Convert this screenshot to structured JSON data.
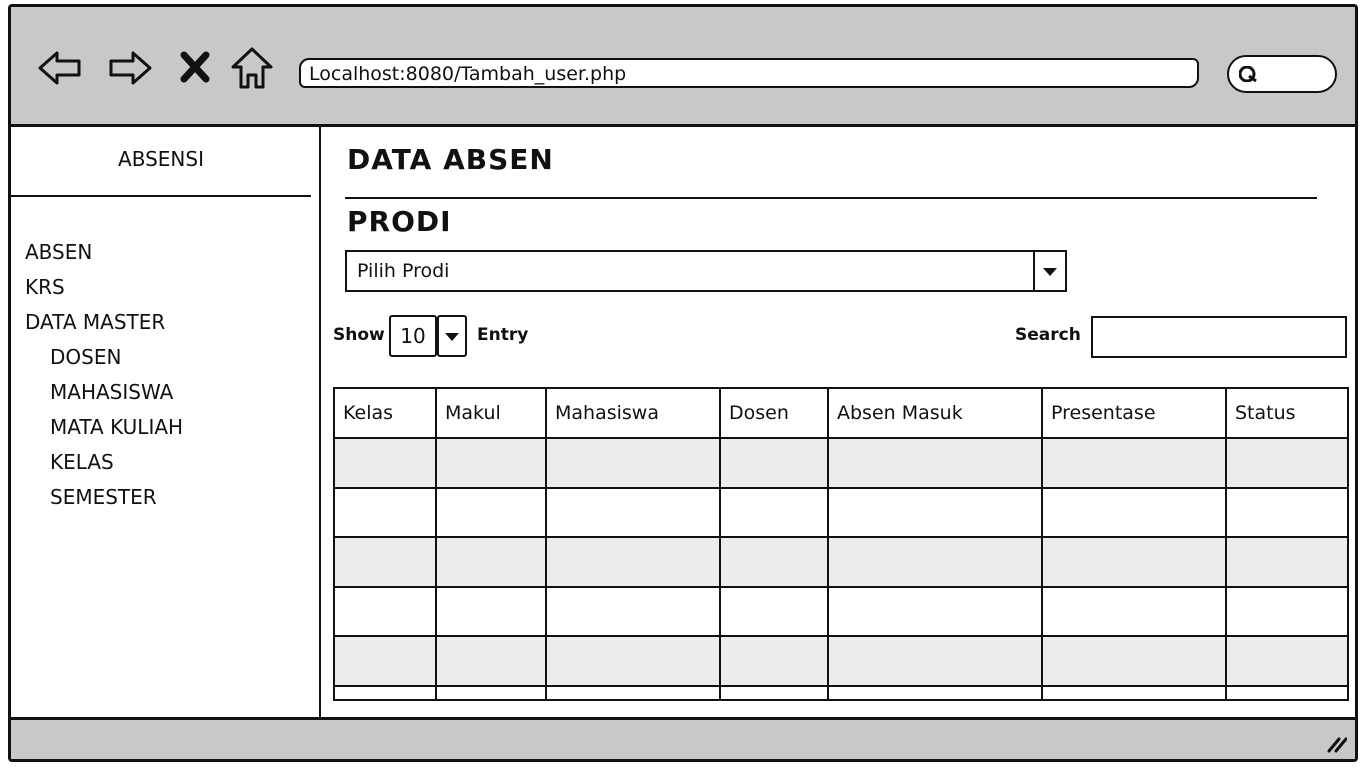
{
  "browser": {
    "url": "Localhost:8080/Tambah_user.php",
    "buttons": {
      "back": "back-arrow-icon",
      "forward": "forward-arrow-icon",
      "stop": "close-icon",
      "home": "home-icon"
    },
    "search_icon": "search-icon"
  },
  "sidebar": {
    "title": "ABSENSI",
    "items": [
      {
        "label": "ABSEN"
      },
      {
        "label": "KRS"
      },
      {
        "label": "DATA MASTER"
      }
    ],
    "subitems": [
      {
        "label": "DOSEN"
      },
      {
        "label": "MAHASISWA"
      },
      {
        "label": "MATA KULIAH"
      },
      {
        "label": "KELAS"
      },
      {
        "label": "SEMESTER"
      }
    ]
  },
  "main": {
    "title": "DATA ABSEN",
    "prodi_label": "PRODI",
    "prodi_select": {
      "value": "Pilih Prodi"
    },
    "show_label": "Show",
    "entries_value": "10",
    "entry_label": "Entry",
    "search_label": "Search",
    "table": {
      "columns": [
        "Kelas",
        "Makul",
        "Mahasiswa",
        "Dosen",
        "Absen Masuk",
        "Presentase",
        "Status"
      ],
      "rows": [
        [
          "",
          "",
          "",
          "",
          "",
          "",
          ""
        ],
        [
          "",
          "",
          "",
          "",
          "",
          "",
          ""
        ],
        [
          "",
          "",
          "",
          "",
          "",
          "",
          ""
        ],
        [
          "",
          "",
          "",
          "",
          "",
          "",
          ""
        ],
        [
          "",
          "",
          "",
          "",
          "",
          "",
          ""
        ]
      ]
    }
  },
  "colors": {
    "chrome": "#c8c8c8",
    "row_shade": "#ececec",
    "ink": "#111111"
  }
}
